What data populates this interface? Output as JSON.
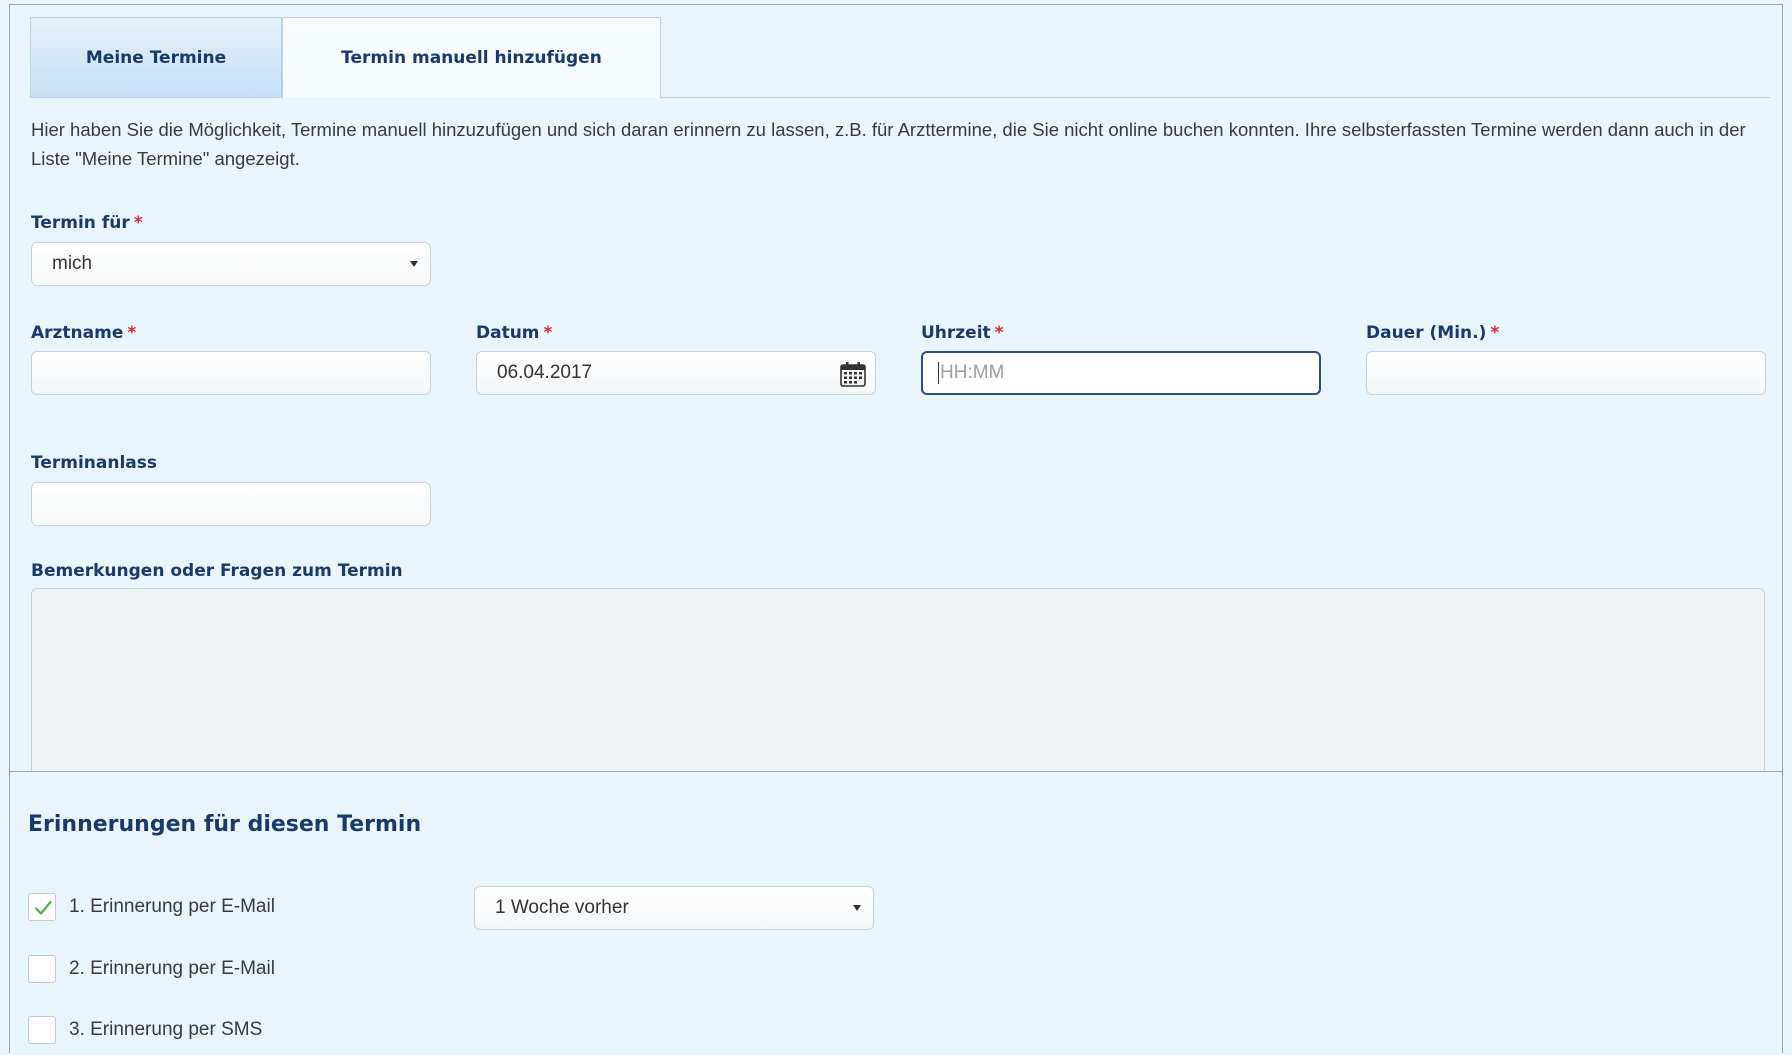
{
  "tabs": [
    {
      "label": "Meine Termine",
      "active": false
    },
    {
      "label": "Termin manuell hinzufügen",
      "active": true
    }
  ],
  "intro_text": "Hier haben Sie die Möglichkeit, Termine manuell hinzuzufügen und sich daran erinnern zu lassen, z.B. für Arzttermine, die Sie nicht online buchen konnten. Ihre selbsterfassten Termine werden dann auch in der Liste \"Meine Termine\" angezeigt.",
  "required_mark": "*",
  "form": {
    "termin_fuer": {
      "label": "Termin für",
      "value": "mich"
    },
    "arztname": {
      "label": "Arztname",
      "value": ""
    },
    "datum": {
      "label": "Datum",
      "value": "06.04.2017"
    },
    "uhrzeit": {
      "label": "Uhrzeit",
      "placeholder": "HH:MM",
      "value": ""
    },
    "dauer": {
      "label": "Dauer (Min.)",
      "value": ""
    },
    "terminanlass": {
      "label": "Terminanlass",
      "value": ""
    },
    "bemerkungen": {
      "label": "Bemerkungen oder Fragen zum Termin",
      "value": ""
    }
  },
  "reminders": {
    "title": "Erinnerungen für diesen Termin",
    "items": [
      {
        "label": "1. Erinnerung per E-Mail",
        "checked": true,
        "select_value": "1 Woche vorher"
      },
      {
        "label": "2. Erinnerung per E-Mail",
        "checked": false
      },
      {
        "label": "3. Erinnerung per SMS",
        "checked": false
      }
    ]
  },
  "icons": {
    "calendar": "calendar-icon",
    "checkmark": "checkmark-icon",
    "caret": "caret-down-icon"
  },
  "colors": {
    "heading": "#1b3a6b",
    "required": "#e0262b",
    "background": "#e9f5fd",
    "check": "#4caf50"
  }
}
